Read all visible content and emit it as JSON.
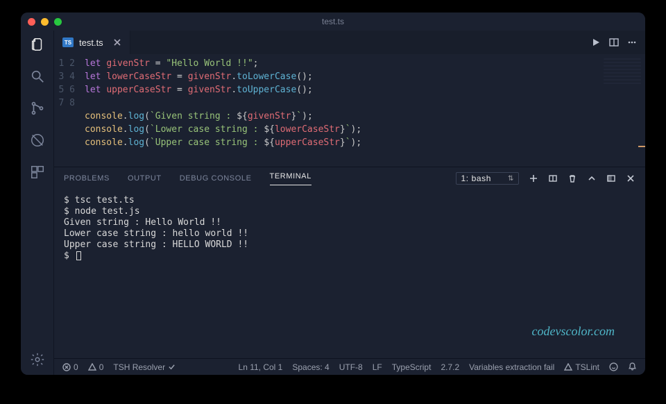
{
  "titlebar": {
    "title": "test.ts"
  },
  "tabs": {
    "file_badge": "TS",
    "file_name": "test.ts"
  },
  "editor": {
    "lines": [
      "1",
      "2",
      "3",
      "4",
      "5",
      "6",
      "7",
      "8"
    ],
    "l1_kw": "let",
    "l1_var": "givenStr",
    "l1_eq": " = ",
    "l1_str": "\"Hello World !!\"",
    "l1_end": ";",
    "l2_kw": "let",
    "l2_var": "lowerCaseStr",
    "l2_eq": " = ",
    "l2_rhs": "givenStr",
    "l2_dot": ".",
    "l2_fn": "toLowerCase",
    "l2_paren": "()",
    "l2_end": ";",
    "l3_kw": "let",
    "l3_var": "upperCaseStr",
    "l3_eq": " = ",
    "l3_rhs": "givenStr",
    "l3_dot": ".",
    "l3_fn": "toUpperCase",
    "l3_paren": "()",
    "l3_end": ";",
    "l5_obj": "console",
    "l5_dot": ".",
    "l5_fn": "log",
    "l5_open": "(",
    "l5_t1": "`Given string : ",
    "l5_do": "${",
    "l5_ti": "givenStr",
    "l5_dc": "}",
    "l5_t2": "`",
    "l5_close": ")",
    "l5_end": ";",
    "l6_obj": "console",
    "l6_dot": ".",
    "l6_fn": "log",
    "l6_open": "(",
    "l6_t1": "`Lower case string : ",
    "l6_do": "${",
    "l6_ti": "lowerCaseStr",
    "l6_dc": "}",
    "l6_t2": "`",
    "l6_close": ")",
    "l6_end": ";",
    "l7_obj": "console",
    "l7_dot": ".",
    "l7_fn": "log",
    "l7_open": "(",
    "l7_t1": "`Upper case string : ",
    "l7_do": "${",
    "l7_ti": "upperCaseStr",
    "l7_dc": "}",
    "l7_t2": "`",
    "l7_close": ")",
    "l7_end": ";"
  },
  "panel": {
    "tabs": {
      "problems": "PROBLEMS",
      "output": "OUTPUT",
      "debug": "DEBUG CONSOLE",
      "terminal": "TERMINAL"
    },
    "shell_label": "1: bash"
  },
  "terminal": {
    "l1": "$ tsc test.ts",
    "l2": "$ node test.js",
    "l3": "Given string : Hello World !!",
    "l4": "Lower case string : hello world !!",
    "l5": "Upper case string : HELLO WORLD !!",
    "l6": "$ "
  },
  "status": {
    "errors": "0",
    "warnings": "0",
    "resolver": "TSH Resolver",
    "cursor": "Ln 11, Col 1",
    "spaces": "Spaces: 4",
    "encoding": "UTF-8",
    "eol": "LF",
    "language": "TypeScript",
    "version": "2.7.2",
    "diag": "Variables extraction fail",
    "lint": "TSLint"
  },
  "watermark": "codevscolor.com"
}
